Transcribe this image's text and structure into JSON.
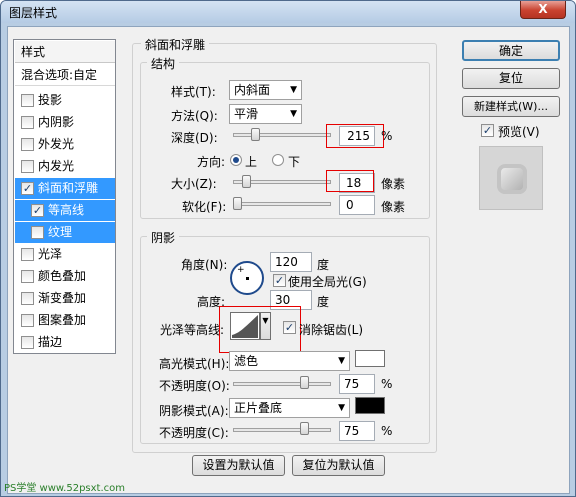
{
  "window": {
    "title": "图层样式",
    "close": "X"
  },
  "sidebar": {
    "header": "样式",
    "blend": "混合选项:自定",
    "items": [
      {
        "label": "投影",
        "checked": false
      },
      {
        "label": "内阴影",
        "checked": false
      },
      {
        "label": "外发光",
        "checked": false
      },
      {
        "label": "内发光",
        "checked": false
      },
      {
        "label": "斜面和浮雕",
        "checked": true
      },
      {
        "label": "等高线",
        "checked": true
      },
      {
        "label": "纹理",
        "checked": false
      },
      {
        "label": "光泽",
        "checked": false
      },
      {
        "label": "颜色叠加",
        "checked": false
      },
      {
        "label": "渐变叠加",
        "checked": false
      },
      {
        "label": "图案叠加",
        "checked": false
      },
      {
        "label": "描边",
        "checked": false
      }
    ]
  },
  "bevel": {
    "title": "斜面和浮雕",
    "structure": {
      "title": "结构",
      "style_label": "样式(T):",
      "style_value": "内斜面",
      "method_label": "方法(Q):",
      "method_value": "平滑",
      "depth_label": "深度(D):",
      "depth_value": "215",
      "depth_unit": "%",
      "depth_slider": 0.2,
      "direction_label": "方向:",
      "dir_up": "上",
      "dir_down": "下",
      "size_label": "大小(Z):",
      "size_value": "18",
      "size_unit": "像素",
      "size_slider": 0.1,
      "soften_label": "软化(F):",
      "soften_value": "0",
      "soften_unit": "像素",
      "soften_slider": 0.0
    },
    "shading": {
      "title": "阴影",
      "angle_label": "角度(N):",
      "angle_value": "120",
      "angle_unit": "度",
      "global_light": "使用全局光(G)",
      "altitude_label": "高度:",
      "altitude_value": "30",
      "altitude_unit": "度",
      "gloss_label": "光泽等高线:",
      "antialias": "消除锯齿(L)",
      "highlight_label": "高光模式(H):",
      "highlight_mode": "滤色",
      "highlight_color": "#ffffff",
      "hl_opacity_label": "不透明度(O):",
      "hl_opacity_value": "75",
      "hl_opacity_unit": "%",
      "hl_opacity_slider": 0.75,
      "shadow_label": "阴影模式(A):",
      "shadow_mode": "正片叠底",
      "shadow_color": "#000000",
      "sh_opacity_label": "不透明度(C):",
      "sh_opacity_value": "75",
      "sh_opacity_unit": "%",
      "sh_opacity_slider": 0.75
    },
    "set_default": "设置为默认值",
    "reset_default": "复位为默认值"
  },
  "buttons": {
    "ok": "确定",
    "reset": "复位",
    "new_style": "新建样式(W)...",
    "preview": "预览(V)"
  },
  "watermark": "PS学堂 www.52psxt.com"
}
